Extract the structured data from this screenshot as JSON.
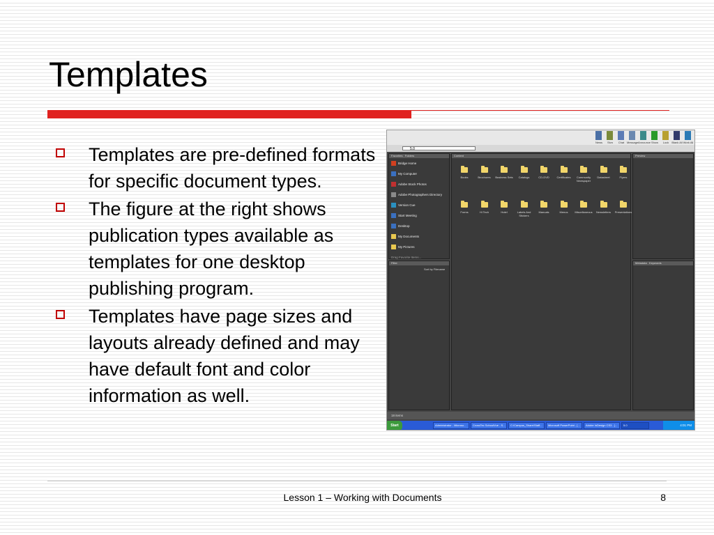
{
  "slide": {
    "title": "Templates",
    "bullets": [
      "Templates are pre-defined formats for specific document types.",
      "The figure at the right shows publication types available as templates for one desktop publishing program.",
      "Templates have page sizes and layouts already defined and may have default font and color information as well."
    ],
    "footer": "Lesson 1 – Working with Documents",
    "page_number": "8"
  },
  "figure": {
    "toolbar_buttons": [
      {
        "label": "News",
        "color": "#4a6fa5"
      },
      {
        "label": "Stvn",
        "color": "#7a8a3a"
      },
      {
        "label": "Chat",
        "color": "#5b7bb5"
      },
      {
        "label": "Message",
        "color": "#6a88b0"
      },
      {
        "label": "Announce",
        "color": "#3a8a8a"
      },
      {
        "label": "Show",
        "color": "#2a9a2a"
      },
      {
        "label": "Lock",
        "color": "#b8a030"
      },
      {
        "label": "Blank All",
        "color": "#303a6a"
      },
      {
        "label": "Work All",
        "color": "#2a7ab5"
      }
    ],
    "address": "5.0",
    "favorites_tab": "Favorites",
    "folders_tab": "Folders",
    "favorites": [
      {
        "label": "Bridge Home",
        "color": "#d04020"
      },
      {
        "label": "My Computer",
        "color": "#3a70c0"
      },
      {
        "label": "Adobe Stock Photos",
        "color": "#c03030"
      },
      {
        "label": "Adobe Photographers Directory",
        "color": "#8a8a8a"
      },
      {
        "label": "Version Cue",
        "color": "#2a90c0"
      },
      {
        "label": "Start Meeting",
        "color": "#3a70c0"
      },
      {
        "label": "Desktop",
        "color": "#3a70c0"
      },
      {
        "label": "My Documents",
        "color": "#e8c850"
      },
      {
        "label": "My Pictures",
        "color": "#e8c850"
      }
    ],
    "favorites_hint": "Drag Favorite Items...",
    "content_tab": "Content",
    "preview_tab": "Preview",
    "filter_tab": "Filter",
    "metadata_tab": "Metadata",
    "keywords_tab": "Keywords",
    "sort_label": "Sort by Filename",
    "folders_row1": [
      "Books",
      "Brochures",
      "Business Sets",
      "Catalogs",
      "CD-DVD",
      "Certificates",
      "Community Newspaper",
      "Datasheet",
      "Flyers"
    ],
    "folders_row2": [
      "Forms",
      "Hi Tech",
      "Hotel",
      "Labels And Stickers",
      "Manuals",
      "Menus",
      "Miscellaneous",
      "Newsletters",
      "Presentations"
    ],
    "status": "18 items",
    "start_label": "Start",
    "taskbar_items": [
      "Administrator - Microso...",
      "CrossTec SchoolVue - S...",
      "C:\\Campus_Share\\Staff...",
      "Microsoft PowerPoint - [...",
      "Adobe InDesign CS3 - [...",
      "5.0"
    ],
    "clock": "4:01 PM"
  }
}
